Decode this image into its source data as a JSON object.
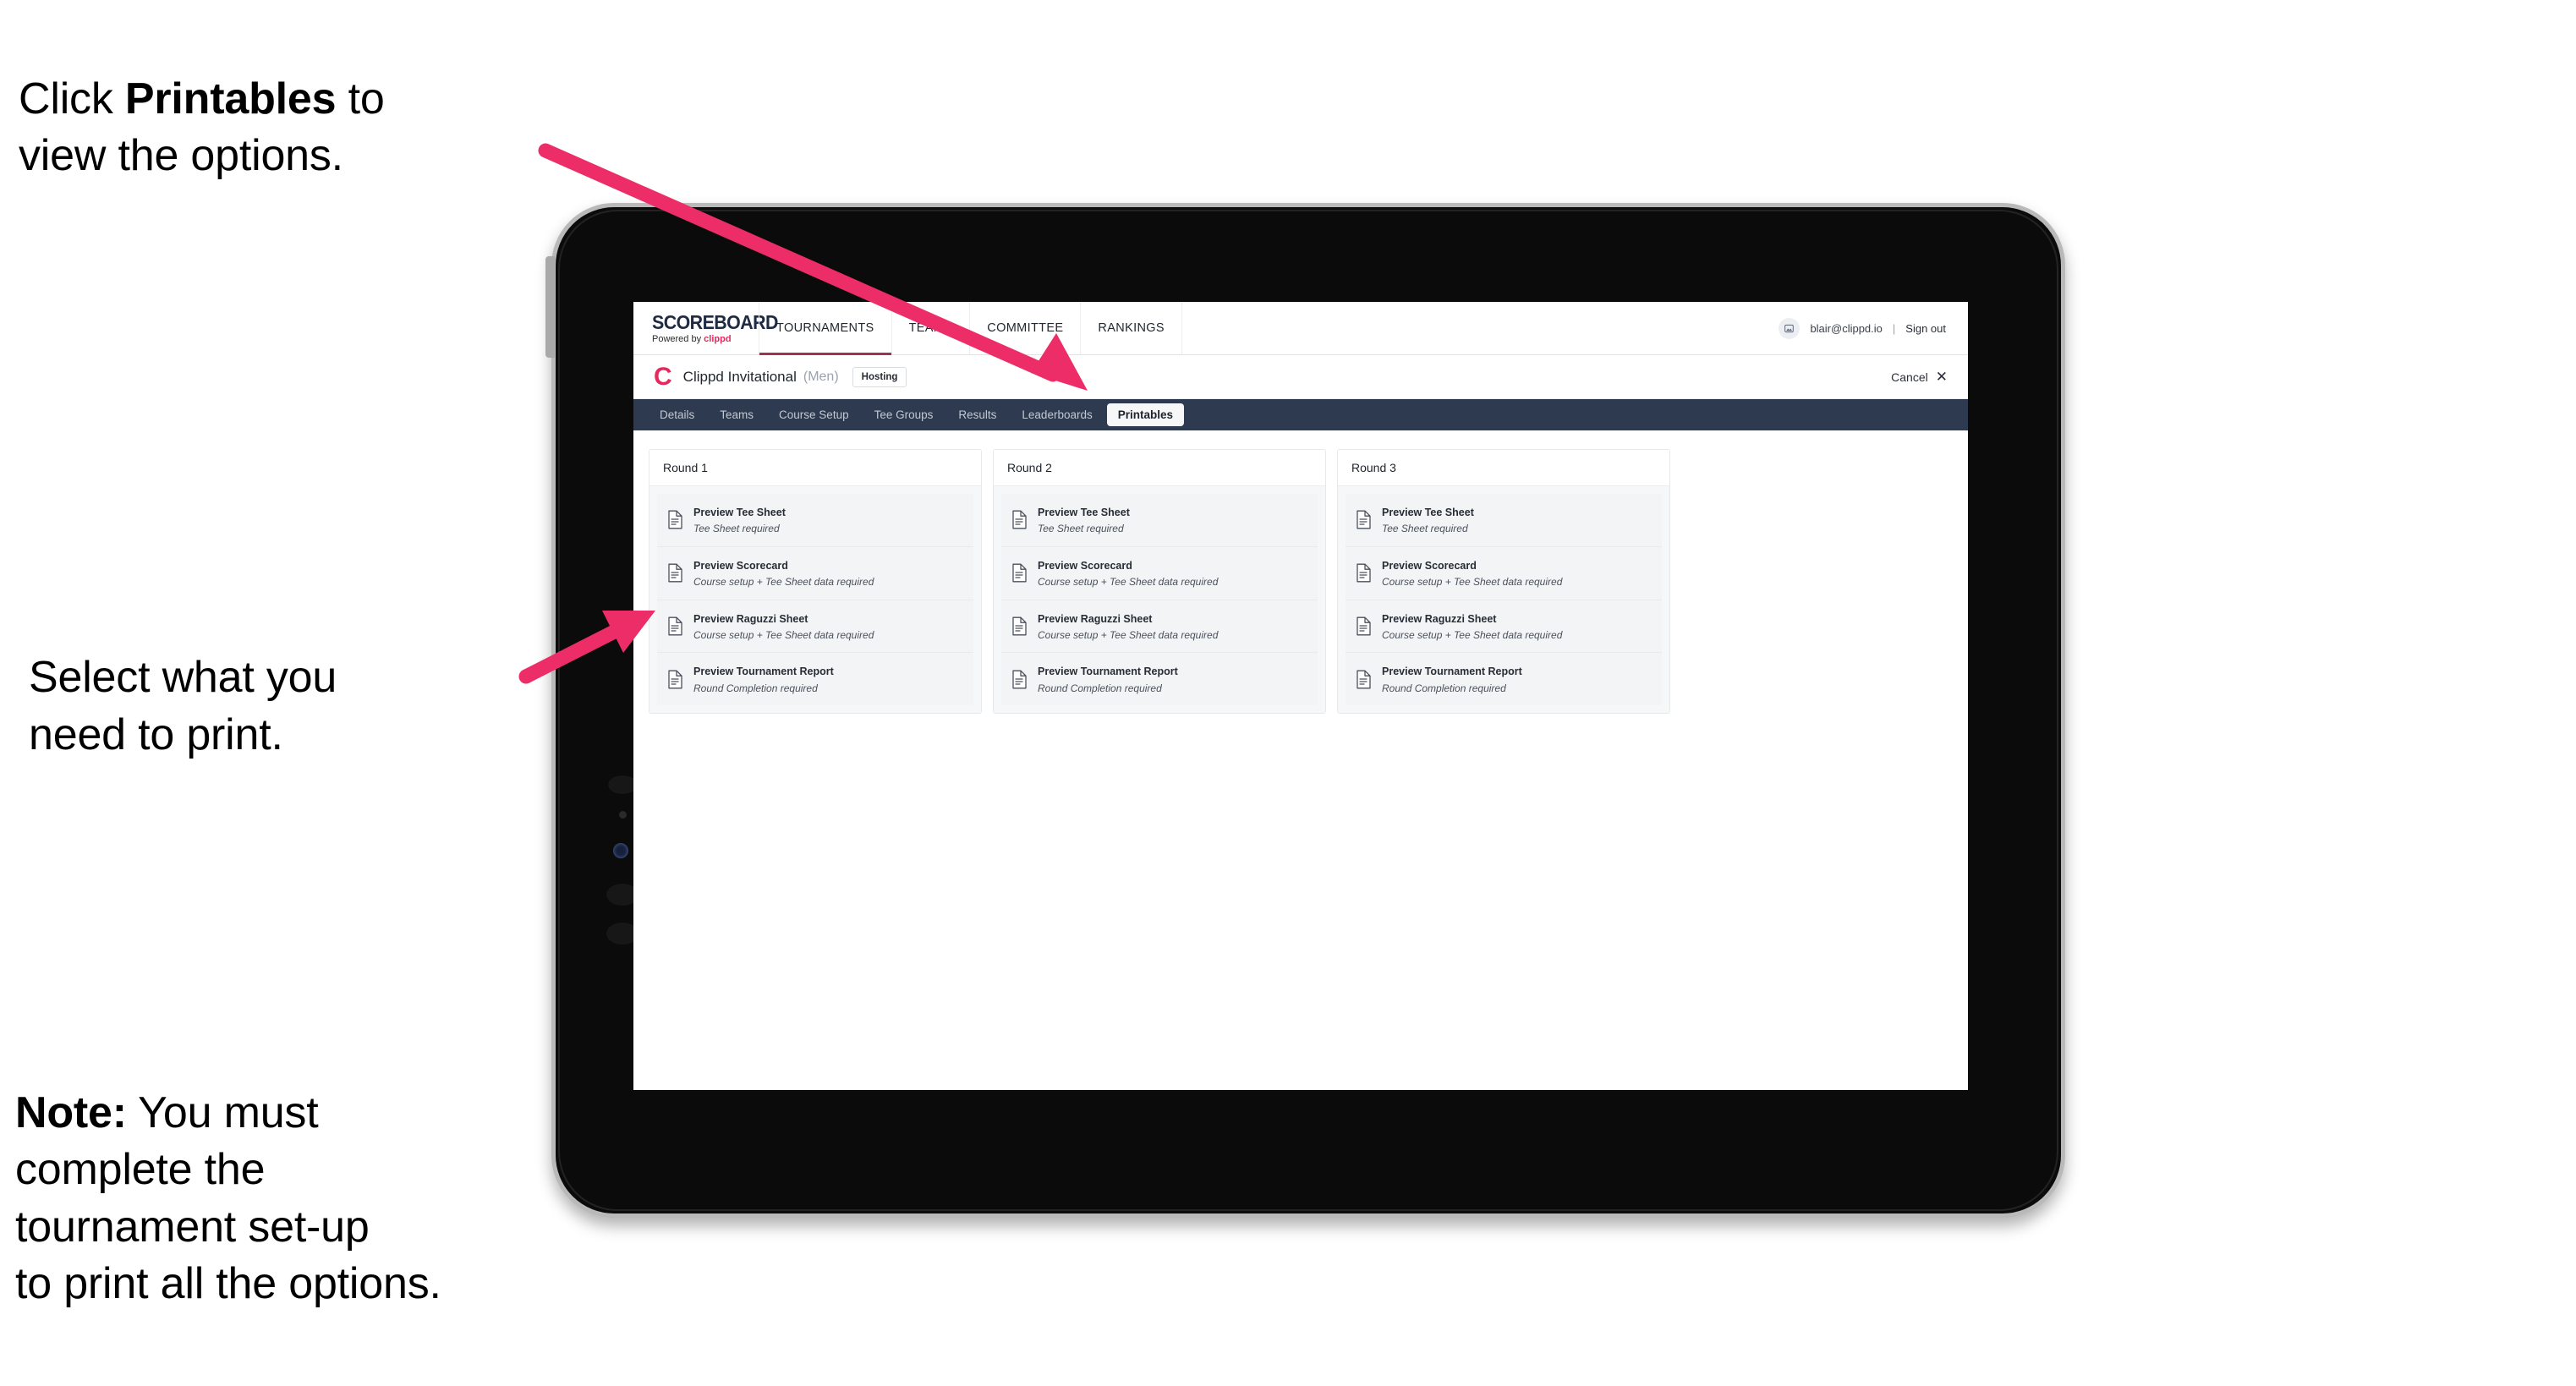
{
  "annotations": {
    "click_printables": "Click Printables to view the options.",
    "click_printables_parts": {
      "pre": "Click ",
      "bold": "Printables",
      "post": " to\nview the options."
    },
    "select_print": "Select what you\n need to print.",
    "note_parts": {
      "bold": "Note:",
      "rest": " You must\ncomplete the\ntournament set-up\nto print all the options."
    }
  },
  "browser": {
    "header": {
      "logo_word": "SCOREBOARD",
      "logo_sub_prefix": "Powered by ",
      "logo_sub_brand": "clippd",
      "nav": [
        {
          "label": "TOURNAMENTS",
          "active": true
        },
        {
          "label": "TEAMS",
          "active": false
        },
        {
          "label": "COMMITTEE",
          "active": false
        },
        {
          "label": "RANKINGS",
          "active": false
        }
      ],
      "avatar_icon": "user-avatar-icon",
      "user_email": "blair@clippd.io",
      "separator": "|",
      "sign_out": "Sign out"
    },
    "tournament_bar": {
      "brand_mark": "C",
      "name": "Clippd Invitational",
      "gender": "(Men)",
      "status_badge": "Hosting",
      "cancel_label": "Cancel",
      "cancel_icon": "close-x-icon"
    },
    "tabs": [
      {
        "label": "Details",
        "active": false
      },
      {
        "label": "Teams",
        "active": false
      },
      {
        "label": "Course Setup",
        "active": false
      },
      {
        "label": "Tee Groups",
        "active": false
      },
      {
        "label": "Results",
        "active": false
      },
      {
        "label": "Leaderboards",
        "active": false
      },
      {
        "label": "Printables",
        "active": true
      }
    ],
    "rounds": [
      {
        "title": "Round 1",
        "items": [
          {
            "icon": "document-icon",
            "title": "Preview Tee Sheet",
            "subtitle": "Tee Sheet required"
          },
          {
            "icon": "document-icon",
            "title": "Preview Scorecard",
            "subtitle": "Course setup + Tee Sheet data required"
          },
          {
            "icon": "document-icon",
            "title": "Preview Raguzzi Sheet",
            "subtitle": "Course setup + Tee Sheet data required"
          },
          {
            "icon": "document-icon",
            "title": "Preview Tournament Report",
            "subtitle": "Round Completion required"
          }
        ]
      },
      {
        "title": "Round 2",
        "items": [
          {
            "icon": "document-icon",
            "title": "Preview Tee Sheet",
            "subtitle": "Tee Sheet required"
          },
          {
            "icon": "document-icon",
            "title": "Preview Scorecard",
            "subtitle": "Course setup + Tee Sheet data required"
          },
          {
            "icon": "document-icon",
            "title": "Preview Raguzzi Sheet",
            "subtitle": "Course setup + Tee Sheet data required"
          },
          {
            "icon": "document-icon",
            "title": "Preview Tournament Report",
            "subtitle": "Round Completion required"
          }
        ]
      },
      {
        "title": "Round 3",
        "items": [
          {
            "icon": "document-icon",
            "title": "Preview Tee Sheet",
            "subtitle": "Tee Sheet required"
          },
          {
            "icon": "document-icon",
            "title": "Preview Scorecard",
            "subtitle": "Course setup + Tee Sheet data required"
          },
          {
            "icon": "document-icon",
            "title": "Preview Raguzzi Sheet",
            "subtitle": "Course setup + Tee Sheet data required"
          },
          {
            "icon": "document-icon",
            "title": "Preview Tournament Report",
            "subtitle": "Round Completion required"
          }
        ]
      }
    ]
  },
  "colors": {
    "accent_pink": "#ec2d67",
    "brand_red": "#e4295c",
    "tab_bar_navy": "#2e3a4f",
    "nav_active_underline": "#9e3250",
    "card_bg": "#f3f4f5",
    "device_bezel": "#0b0b0b",
    "device_rim": "#b9b9b9"
  }
}
